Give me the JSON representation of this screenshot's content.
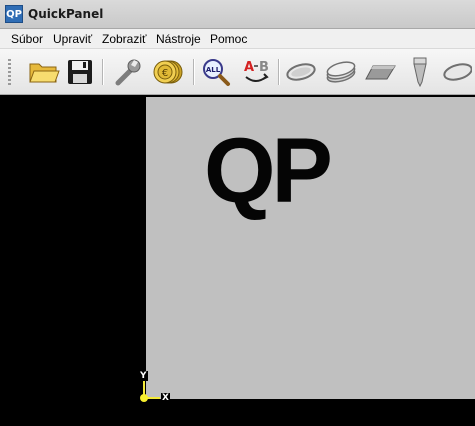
{
  "window": {
    "title": "QuickPanel",
    "icon_text": "QP"
  },
  "menu": {
    "items": [
      {
        "label": "Súbor"
      },
      {
        "label": "Upraviť"
      },
      {
        "label": "Zobraziť"
      },
      {
        "label": "Nástroje"
      },
      {
        "label": "Pomoc"
      }
    ]
  },
  "toolbar": {
    "icons": [
      "open-folder-icon",
      "save-disk-icon",
      "wrench-icon",
      "euro-coins-icon",
      "zoom-all-icon",
      "a-b-swap-icon",
      "ellipse-plate-icon",
      "stacked-plates-icon",
      "parallelogram-plate-icon",
      "drill-bit-icon",
      "oval-icon"
    ],
    "zoom_all_text": "ALL",
    "ab_text_a": "A",
    "ab_text_b": "B"
  },
  "canvas": {
    "logo_text": "QP",
    "axis_y_label": "Y",
    "axis_x_label": "X",
    "background_color": "#000000",
    "sheet_color": "#c0c0c0",
    "axis_color": "#f4ea3a"
  }
}
